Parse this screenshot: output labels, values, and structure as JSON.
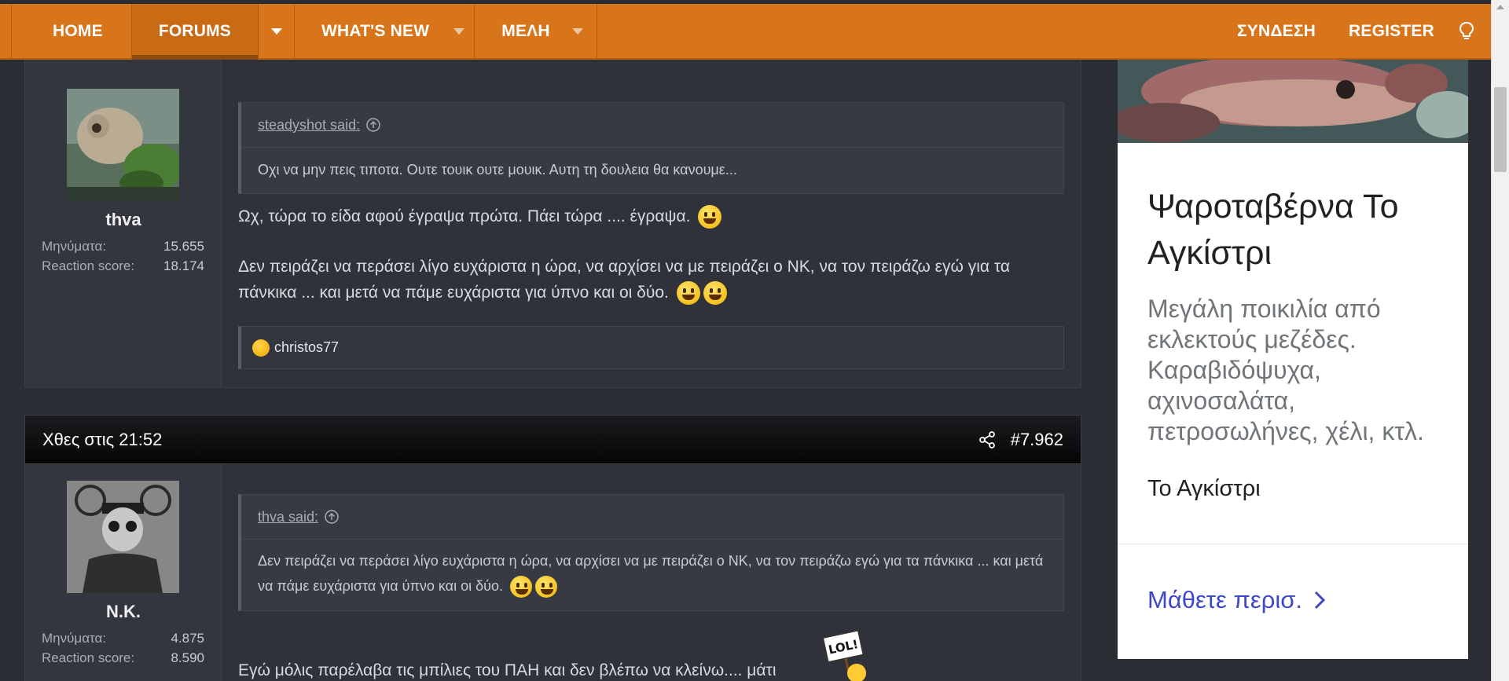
{
  "nav": {
    "home": "HOME",
    "forums": "FORUMS",
    "whats_new": "WHAT'S NEW",
    "members": "ΜΕΛΗ",
    "login": "ΣΥΝΔΕΣΗ",
    "register": "REGISTER",
    "theme_icon": "lightbulb-icon",
    "accent_color": "#d8751b"
  },
  "post1": {
    "username": "thva",
    "messages_label": "Μηνύματα:",
    "messages_value": "15.655",
    "reaction_label": "Reaction score:",
    "reaction_value": "18.174",
    "quote_author": "steadyshot said:",
    "quote_text": "Οχι να μην πεις τιποτα. Ουτε τουικ ουτε μουικ. Αυτη τη δουλεια θα κανουμε...",
    "line1": "Ωχ, τώρα το είδα αφού έγραψα πρώτα. Πάει τώρα .... έγραψα.",
    "line2": "Δεν πειράζει να περάσει λίγο ευχάριστα η ώρα, να αρχίσει να με πειράζει ο ΝΚ, να τον πειράζω εγώ για τα πάνκικα ... και μετά να πάμε ευχάριστα για ύπνο και οι δύο.",
    "reaction_user": "christos77"
  },
  "post2": {
    "time": "Χθες στις 21:52",
    "post_number": "#7.962",
    "username": "N.K.",
    "messages_label": "Μηνύματα:",
    "messages_value": "4.875",
    "reaction_label": "Reaction score:",
    "reaction_value": "8.590",
    "quote_author": "thva said:",
    "quote_text": "Δεν πειράζει να περάσει λίγο ευχάριστα η ώρα, να αρχίσει να με πειράζει ο ΝΚ, να τον πειράζω εγώ για τα πάνκικα ... και μετά να πάμε ευχάριστα για ύπνο και οι δύο.",
    "line1": "Εγώ μόλις παρέλαβα τις μπίλιες του ΠΑΗ και δεν βλέπω να κλείνω.... μάτι",
    "sticker_text": "LOL!"
  },
  "ad": {
    "title": "Ψαροταβέρνα Το Αγκίστρι",
    "description": "Μεγάλη ποικιλία από εκλεκτούς μεζέδες. Καραβιδόψυχα, αχινοσαλάτα, πετροσωλήνες, χέλι, κτλ.",
    "name": "Το Αγκίστρι",
    "cta": "Μάθετε περισ.",
    "cta_color": "#3c48c9"
  }
}
